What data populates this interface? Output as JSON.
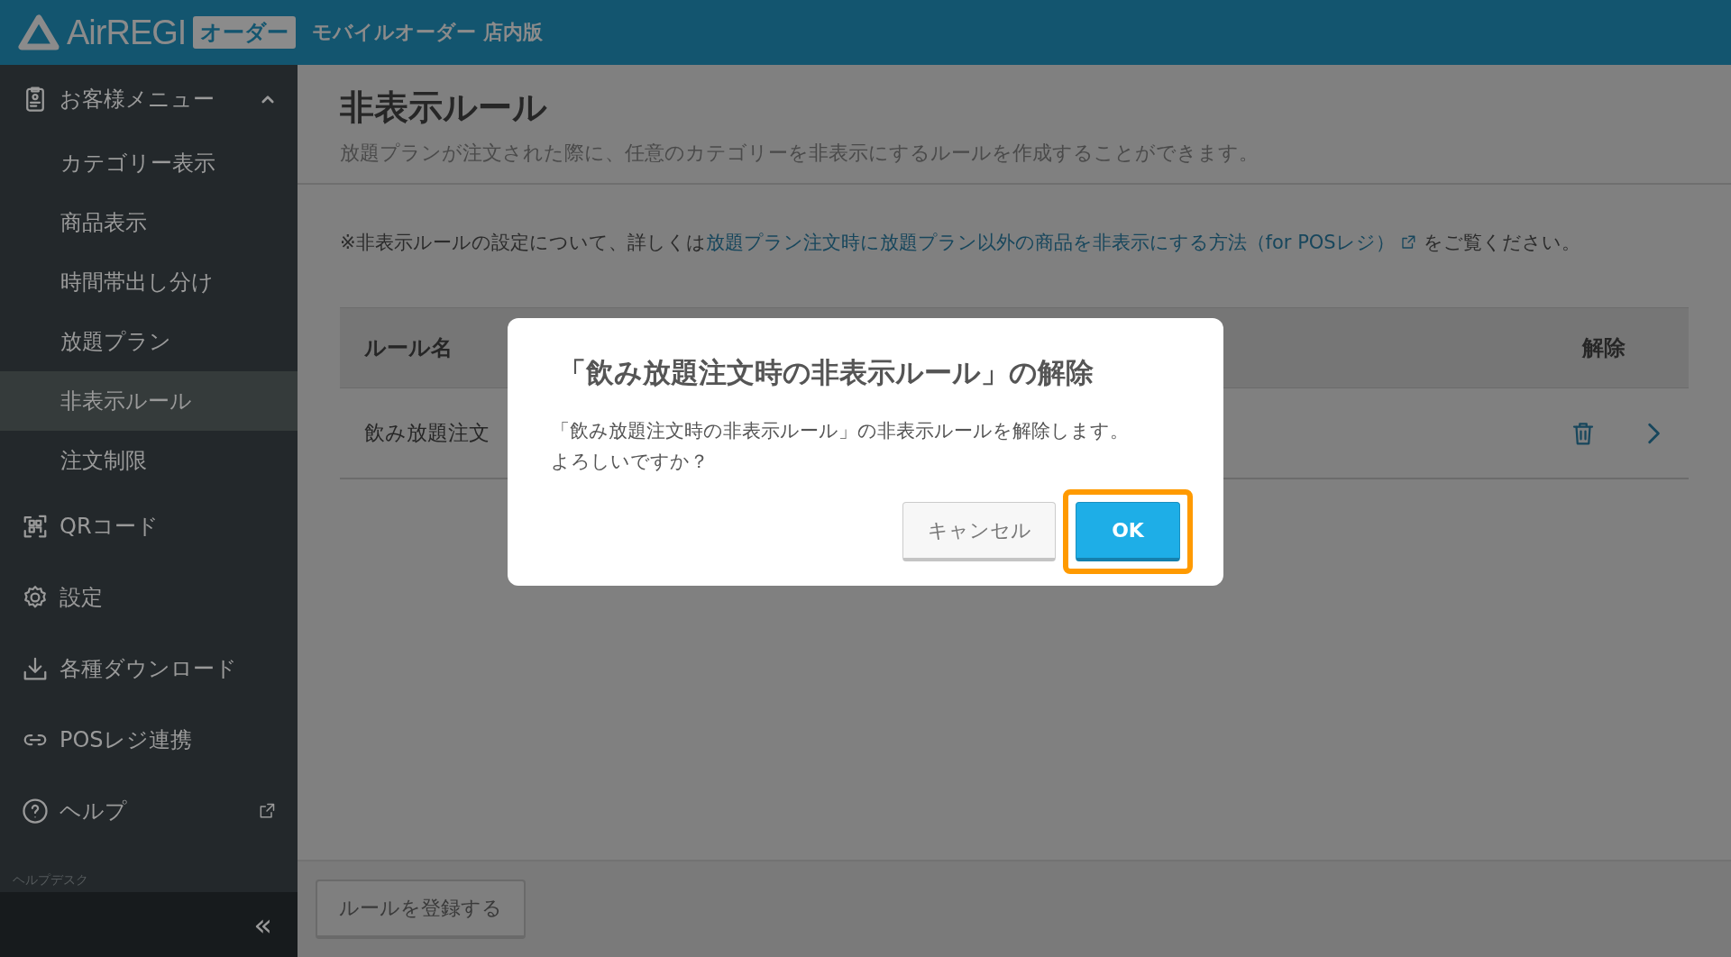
{
  "header": {
    "logo": "AirREGI",
    "badge": "オーダー",
    "subtitle": "モバイルオーダー 店内版"
  },
  "sidebar": {
    "items": [
      {
        "kind": "group",
        "label": "お客様メニュー",
        "expanded": true,
        "children": [
          {
            "label": "カテゴリー表示",
            "selected": false
          },
          {
            "label": "商品表示",
            "selected": false
          },
          {
            "label": "時間帯出し分け",
            "selected": false
          },
          {
            "label": "放題プラン",
            "selected": false
          },
          {
            "label": "非表示ルール",
            "selected": true
          },
          {
            "label": "注文制限",
            "selected": false
          }
        ]
      },
      {
        "kind": "link",
        "label": "QRコード"
      },
      {
        "kind": "link",
        "label": "設定"
      },
      {
        "kind": "link",
        "label": "各種ダウンロード"
      },
      {
        "kind": "link",
        "label": "POSレジ連携"
      },
      {
        "kind": "external",
        "label": "ヘルプ"
      }
    ],
    "section_label": "ヘルプデスク",
    "collapse": "«"
  },
  "page": {
    "title": "非表示ルール",
    "description": "放題プランが注文された際に、任意のカテゴリーを非表示にするルールを作成することができます。",
    "note": {
      "before": "※非表示ルールの設定について、詳しくは",
      "link": "放題プラン注文時に放題プラン以外の商品を非表示にする方法（for POSレジ）",
      "after": "をご覧ください。"
    }
  },
  "table": {
    "columns": [
      "ルール名",
      "解除"
    ],
    "rows": [
      {
        "name": "飲み放題注文"
      }
    ]
  },
  "footer": {
    "button": "ルールを登録する"
  },
  "dialog": {
    "title": "「飲み放題注文時の非表示ルール」の解除",
    "message": [
      "「飲み放題注文時の非表示ルール」の非表示ルールを解除します。",
      "よろしいですか？"
    ],
    "buttons": [
      {
        "label": "キャンセル",
        "kind": "secondary",
        "highlighted": false
      },
      {
        "label": "OK",
        "kind": "primary",
        "highlighted": true
      }
    ]
  }
}
